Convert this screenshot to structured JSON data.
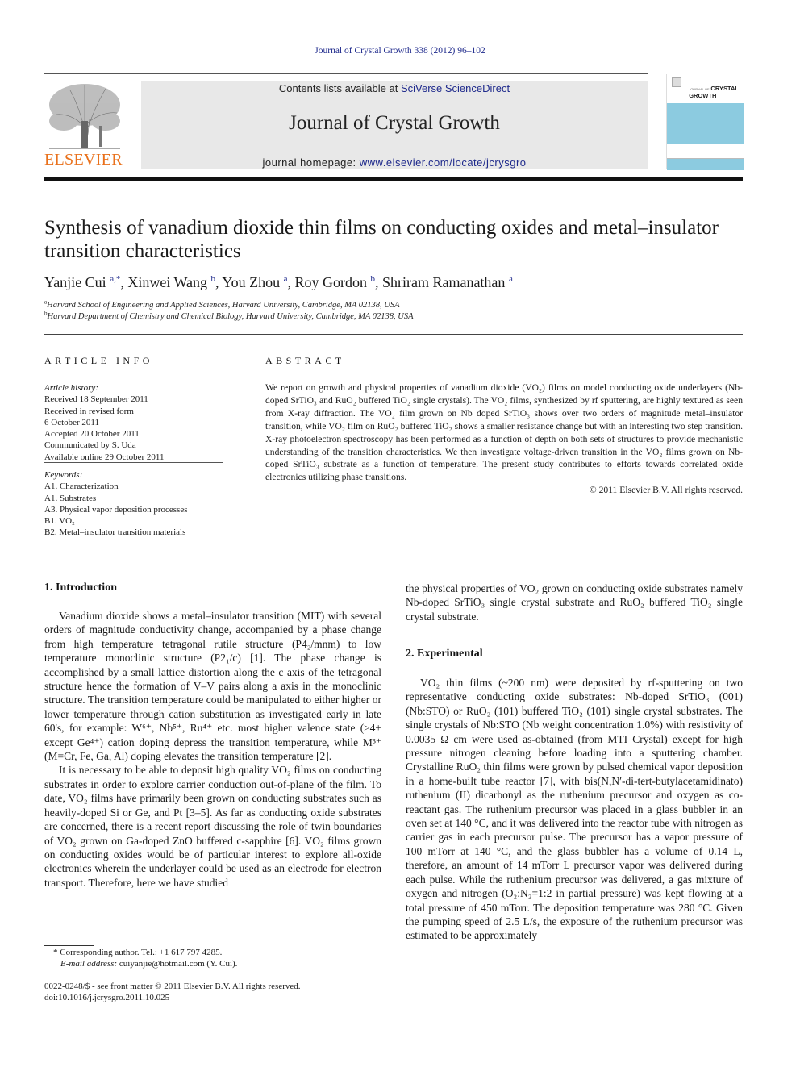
{
  "header": {
    "citation": "Journal of Crystal Growth 338 (2012) 96–102",
    "contents_prefix": "Contents lists available at ",
    "contents_link": "SciVerse ScienceDirect",
    "journal_title": "Journal of Crystal Growth",
    "homepage_prefix": "journal homepage: ",
    "homepage_link": "www.elsevier.com/locate/jcrysgro",
    "publisher_logo_text": "ELSEVIER",
    "cover_small_text": "JOURNAL OF",
    "cover_title_line1": "CRYSTAL",
    "cover_title_line2": "GROWTH",
    "colors": {
      "publisher_orange": "#e9711c",
      "link_blue": "#1f2a8c",
      "banner_gray": "#e8e8e8",
      "cover_blue": "#8ccbe0"
    }
  },
  "article": {
    "title": "Synthesis of vanadium dioxide thin films on conducting oxides and metal–insulator transition characteristics",
    "authors": [
      {
        "name": "Yanjie Cui",
        "aff": "a,*",
        "sep": ", "
      },
      {
        "name": "Xinwei Wang",
        "aff": "b",
        "sep": ", "
      },
      {
        "name": "You Zhou",
        "aff": "a",
        "sep": ", "
      },
      {
        "name": "Roy Gordon",
        "aff": "b",
        "sep": ", "
      },
      {
        "name": "Shriram Ramanathan",
        "aff": "a",
        "sep": ""
      }
    ],
    "affiliations": [
      {
        "mark": "a",
        "text": "Harvard School of Engineering and Applied Sciences, Harvard University, Cambridge, MA 02138, USA"
      },
      {
        "mark": "b",
        "text": "Harvard Department of Chemistry and Chemical Biology, Harvard University, Cambridge, MA 02138, USA"
      }
    ]
  },
  "article_info": {
    "heading": "ARTICLE INFO",
    "history_label": "Article history:",
    "history": [
      "Received 18 September 2011",
      "Received in revised form",
      "6 October 2011",
      "Accepted 20 October 2011",
      "Communicated by S. Uda",
      "Available online 29 October 2011"
    ],
    "keywords_label": "Keywords:",
    "keywords": [
      "A1. Characterization",
      "A1. Substrates",
      "A3. Physical vapor deposition processes",
      "B1. VO₂",
      "B2. Metal–insulator transition materials"
    ]
  },
  "abstract": {
    "heading": "ABSTRACT",
    "text": "We report on growth and physical properties of vanadium dioxide (VO₂) films on model conducting oxide underlayers (Nb-doped SrTiO₃ and RuO₂ buffered TiO₂ single crystals). The VO₂ films, synthesized by rf sputtering, are highly textured as seen from X-ray diffraction. The VO₂ film grown on Nb doped SrTiO₃ shows over two orders of magnitude metal–insulator transition, while VO₂ film on RuO₂ buffered TiO₂ shows a smaller resistance change but with an interesting two step transition. X-ray photoelectron spectroscopy has been performed as a function of depth on both sets of structures to provide mechanistic understanding of the transition characteristics. We then investigate voltage-driven transition in the VO₂ films grown on Nb-doped SrTiO₃ substrate as a function of temperature. The present study contributes to efforts towards correlated oxide electronics utilizing phase transitions.",
    "copyright": "© 2011 Elsevier B.V. All rights reserved."
  },
  "sections": {
    "intro_heading": "1.  Introduction",
    "intro_p1": "Vanadium dioxide shows a metal–insulator transition (MIT) with several orders of magnitude conductivity change, accompanied by a phase change from high temperature tetragonal rutile structure (P4₂/mnm) to low temperature monoclinic structure (P2₁/c) [1]. The phase change is accomplished by a small lattice distortion along the c axis of the tetragonal structure hence the formation of V–V pairs along a axis in the monoclinic structure. The transition temperature could be manipulated to either higher or lower temperature through cation substitution as investigated early in late 60's, for example: W⁶⁺, Nb⁵⁺, Ru⁴⁺ etc. most higher valence state (≥4+ except Ge⁴⁺) cation doping depress the transition temperature, while M³⁺ (M=Cr, Fe, Ga, Al) doping elevates the transition temperature [2].",
    "intro_p2": "It is necessary to be able to deposit high quality VO₂ films on conducting substrates in order to explore carrier conduction out-of-plane of the film. To date, VO₂ films have primarily been grown on conducting substrates such as heavily-doped Si or Ge, and Pt [3–5]. As far as conducting oxide substrates are concerned, there is a recent report discussing the role of twin boundaries of VO₂ grown on Ga-doped ZnO buffered c-sapphire [6]. VO₂ films grown on conducting oxides would be of particular interest to explore all-oxide electronics wherein the underlayer could be used as an electrode for electron transport. Therefore, here we have studied",
    "intro_p2_cont": "the physical properties of VO₂ grown on conducting oxide substrates namely Nb-doped SrTiO₃ single crystal substrate and RuO₂ buffered TiO₂ single crystal substrate.",
    "exp_heading": "2.  Experimental",
    "exp_p1": "VO₂ thin films (~200 nm) were deposited by rf-sputtering on two representative conducting oxide substrates: Nb-doped SrTiO₃ (001) (Nb:STO) or RuO₂ (101) buffered TiO₂ (101) single crystal substrates. The single crystals of Nb:STO (Nb weight concentration 1.0%) with resistivity of 0.0035 Ω cm were used as-obtained (from MTI Crystal) except for high pressure nitrogen cleaning before loading into a sputtering chamber. Crystalline RuO₂ thin films were grown by pulsed chemical vapor deposition in a home-built tube reactor [7], with bis(N,N′-di-tert-butylacetamidinato) ruthenium (II) dicarbonyl as the ruthenium precursor and oxygen as co-reactant gas. The ruthenium precursor was placed in a glass bubbler in an oven set at 140 °C, and it was delivered into the reactor tube with nitrogen as carrier gas in each precursor pulse. The precursor has a vapor pressure of 100 mTorr at 140 °C, and the glass bubbler has a volume of 0.14 L, therefore, an amount of 14 mTorr L precursor vapor was delivered during each pulse. While the ruthenium precursor was delivered, a gas mixture of oxygen and nitrogen (O₂:N₂=1:2 in partial pressure) was kept flowing at a total pressure of 450 mTorr. The deposition temperature was 280 °C. Given the pumping speed of 2.5 L/s, the exposure of the ruthenium precursor was estimated to be approximately"
  },
  "footnotes": {
    "corresponding": "* Corresponding author. Tel.: +1 617 797 4285.",
    "email_label": "E-mail address: ",
    "email": "cuiyanjie@hotmail.com",
    "email_suffix": " (Y. Cui).",
    "front_matter": "0022-0248/$ - see front matter © 2011 Elsevier B.V. All rights reserved.",
    "doi": "doi:10.1016/j.jcrysgro.2011.10.025"
  }
}
